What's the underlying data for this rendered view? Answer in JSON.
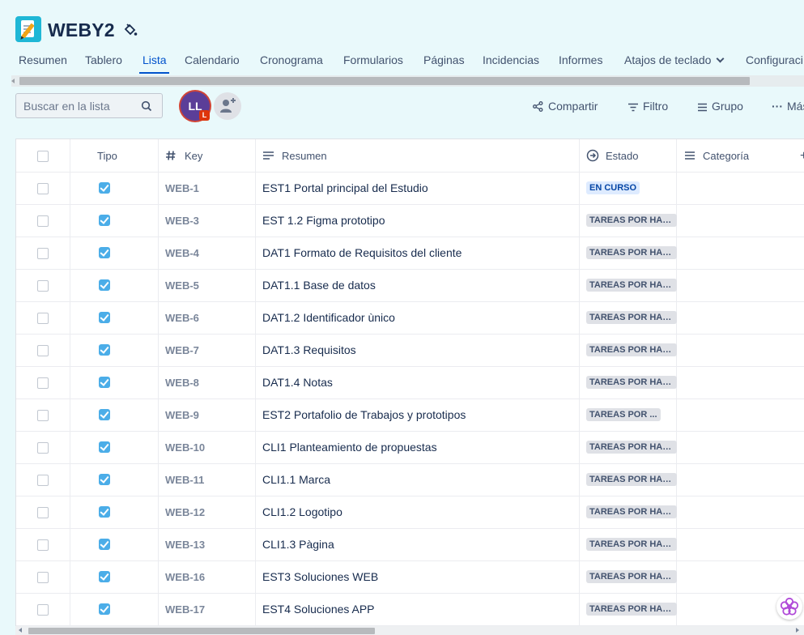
{
  "colors": {
    "background": "#e9f9fb",
    "accent": "#0052cc",
    "type_icon": "#4bade8",
    "status_in_progress_bg": "#deebff",
    "status_todo_bg": "#dfe1e6"
  },
  "project": {
    "name": "WEBY2",
    "icon": "notepad-pencil-icon"
  },
  "tabs": [
    "Resumen",
    "Tablero",
    "Lista",
    "Calendario",
    "Cronograma",
    "Formularios",
    "Páginas",
    "Incidencias",
    "Informes",
    "Atajos de teclado",
    "Configuraci"
  ],
  "active_tab": "Lista",
  "toolbar": {
    "search_placeholder": "Buscar en la lista",
    "avatar_initials": "LL",
    "avatar_badge": "L",
    "share_label": "Compartir",
    "filter_label": "Filtro",
    "group_label": "Grupo",
    "more_label": "Más"
  },
  "table": {
    "headers": {
      "type": "Tipo",
      "key": "Key",
      "summary": "Resumen",
      "status": "Estado",
      "category": "Categoría"
    },
    "rows": [
      {
        "key": "WEB-1",
        "summary": "EST1 Portal principal del Estudio",
        "status": "EN CURSO"
      },
      {
        "key": "WEB-3",
        "summary": "EST 1.2 Figma prototipo",
        "status": "TAREAS POR HAC..."
      },
      {
        "key": "WEB-4",
        "summary": "DAT1 Formato de Requisitos del cliente",
        "status": "TAREAS POR HAC..."
      },
      {
        "key": "WEB-5",
        "summary": "DAT1.1 Base de datos",
        "status": "TAREAS POR HAC..."
      },
      {
        "key": "WEB-6",
        "summary": "DAT1.2 Identificador ùnico",
        "status": "TAREAS POR HAC..."
      },
      {
        "key": "WEB-7",
        "summary": "DAT1.3 Requisitos",
        "status": "TAREAS POR HAC..."
      },
      {
        "key": "WEB-8",
        "summary": "DAT1.4 Notas",
        "status": "TAREAS POR HAC..."
      },
      {
        "key": "WEB-9",
        "summary": "EST2 Portafolio de Trabajos y prototipos",
        "status": "TAREAS POR ..."
      },
      {
        "key": "WEB-10",
        "summary": "CLI1 Planteamiento de propuestas",
        "status": "TAREAS POR HAC..."
      },
      {
        "key": "WEB-11",
        "summary": "CLI1.1 Marca",
        "status": "TAREAS POR HAC..."
      },
      {
        "key": "WEB-12",
        "summary": "CLI1.2 Logotipo",
        "status": "TAREAS POR HAC..."
      },
      {
        "key": "WEB-13",
        "summary": "CLI1.3 Pàgina",
        "status": "TAREAS POR HAC..."
      },
      {
        "key": "WEB-16",
        "summary": "EST3 Soluciones WEB",
        "status": "TAREAS POR HAC..."
      },
      {
        "key": "WEB-17",
        "summary": "EST4 Soluciones APP",
        "status": "TAREAS POR HAC..."
      }
    ]
  }
}
